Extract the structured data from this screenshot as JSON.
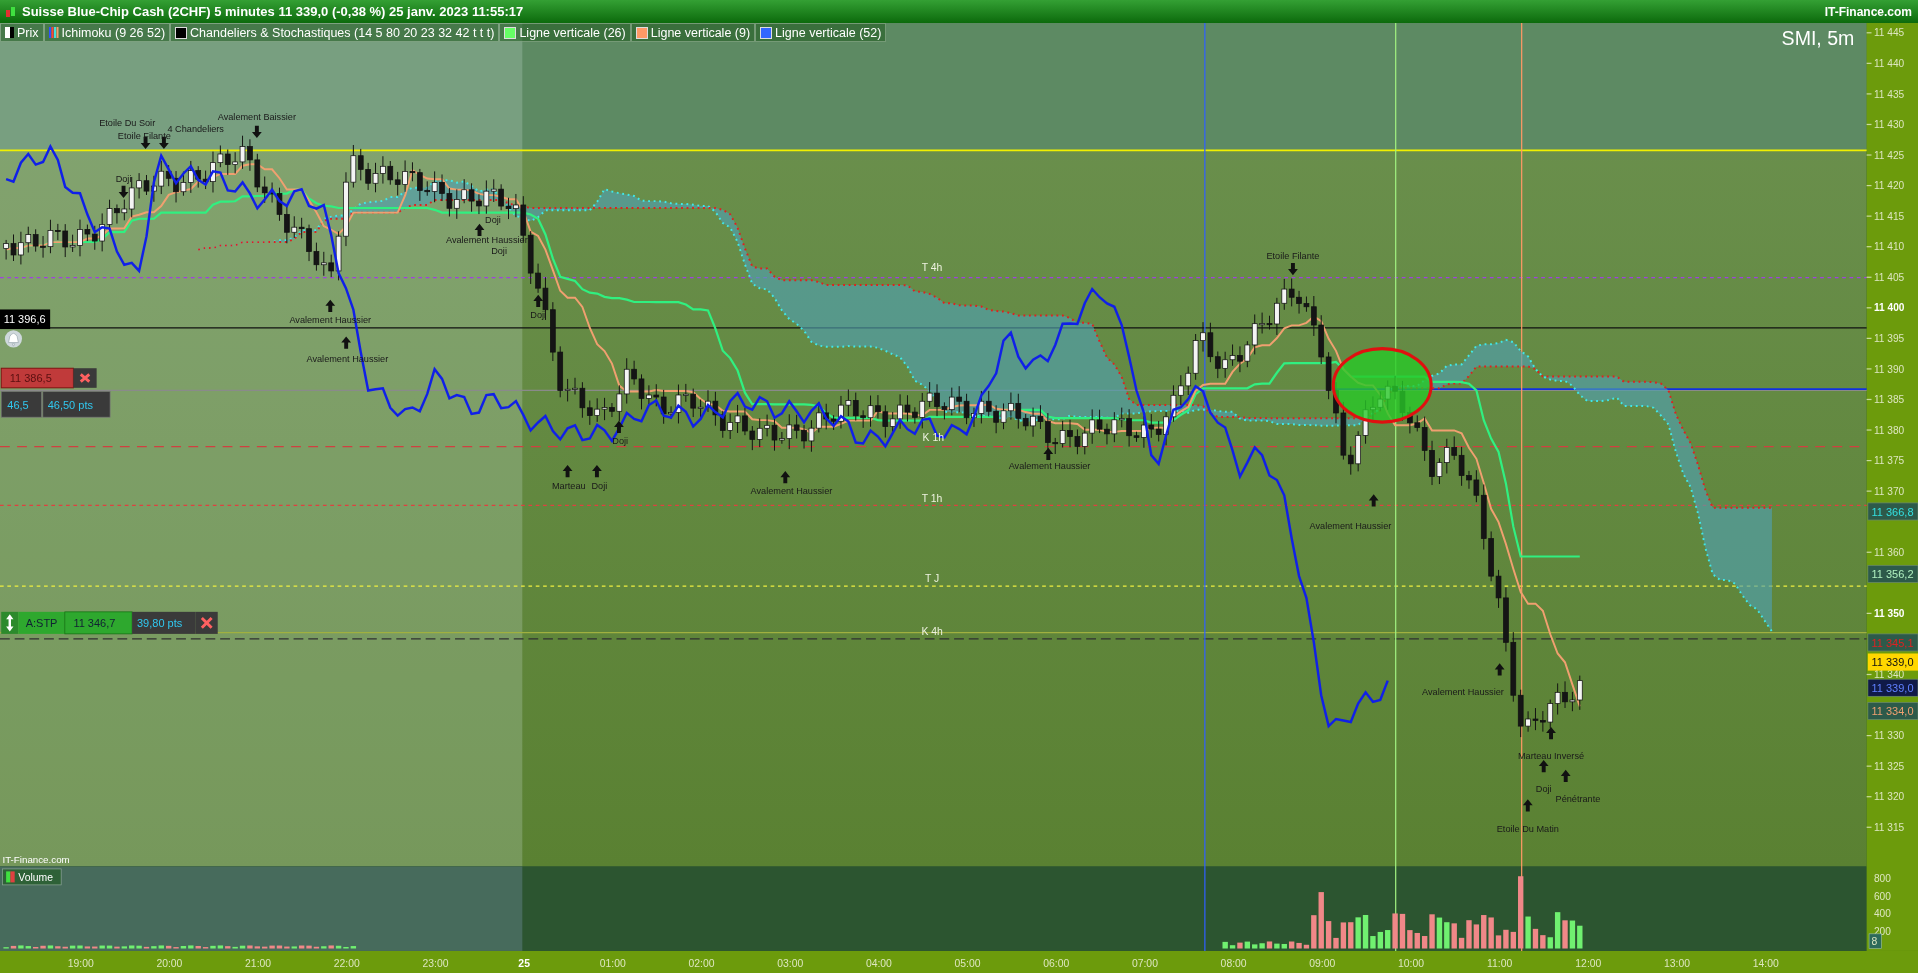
{
  "title_bar": {
    "title": "Suisse Blue-Chip Cash (2CHF) 5 minutes 11 339,0 (-0,38 %) 25 janv. 2023 11:55:17",
    "brand": "IT-Finance.com"
  },
  "legend": [
    {
      "kind": "prix",
      "label": "Prix"
    },
    {
      "kind": "ichimoku",
      "label": "Ichimoku (9 26 52)"
    },
    {
      "kind": "swatch",
      "label": "Chandeliers & Stochastiques (14 5 80 20 23 32 42 t t t)",
      "color": "#000000"
    },
    {
      "kind": "swatch",
      "label": "Ligne verticale (26)",
      "color": "#66ff66"
    },
    {
      "kind": "swatch",
      "label": "Ligne verticale (9)",
      "color": "#ff9966"
    },
    {
      "kind": "swatch",
      "label": "Ligne verticale (52)",
      "color": "#3366ff"
    }
  ],
  "chart": {
    "symbol": "SMI, 5m",
    "source": "IT-Finance.com",
    "cursor_price": "11 396,6",
    "order": {
      "price": "11 386,5",
      "distance": "46,5",
      "distance_pts": "46,50 pts"
    },
    "stop": {
      "type_label": "A:STP",
      "price": "11 346,7",
      "distance_pts": "39,80 pts"
    },
    "line_labels": [
      "T 4h",
      "K 1h",
      "T 1h",
      "T J",
      "K 4h"
    ],
    "patterns": [
      {
        "text": "Etoile Du Soir",
        "kind": "down"
      },
      {
        "text": "4 Chandeliers",
        "kind": "down"
      },
      {
        "text": "Etoile Filante",
        "kind": "plain"
      },
      {
        "text": "Avalement Baissier",
        "kind": "down"
      },
      {
        "text": "Doji",
        "kind": "down"
      },
      {
        "text": "Avalement Haussier",
        "kind": "up"
      },
      {
        "text": "Avalement Haussier",
        "kind": "up"
      },
      {
        "text": "Doji",
        "kind": "plain"
      },
      {
        "text": "Avalement Haussier",
        "kind": "up"
      },
      {
        "text": "Doji",
        "kind": "plain"
      },
      {
        "text": "Doji",
        "kind": "up"
      },
      {
        "text": "Marteau",
        "kind": "up"
      },
      {
        "text": "Doji",
        "kind": "up"
      },
      {
        "text": "Doji",
        "kind": "up"
      },
      {
        "text": "Avalement Haussier",
        "kind": "up"
      },
      {
        "text": "Avalement Haussier",
        "kind": "up"
      },
      {
        "text": "Etoile Filante",
        "kind": "down"
      },
      {
        "text": "Avalement Haussier",
        "kind": "up"
      },
      {
        "text": "Avalement Haussier",
        "kind": "up"
      },
      {
        "text": "Marteau Inversé",
        "kind": "up"
      },
      {
        "text": "Doji",
        "kind": "up"
      },
      {
        "text": "Pénétrante",
        "kind": "up"
      },
      {
        "text": "Etoile Du Matin",
        "kind": "up"
      }
    ],
    "price_axis": {
      "ticks": [
        {
          "label": "11 445",
          "major": false
        },
        {
          "label": "11 440",
          "major": false
        },
        {
          "label": "11 435",
          "major": false
        },
        {
          "label": "11 430",
          "major": false
        },
        {
          "label": "11 425",
          "major": false
        },
        {
          "label": "11 420",
          "major": false
        },
        {
          "label": "11 415",
          "major": false
        },
        {
          "label": "11 410",
          "major": false
        },
        {
          "label": "11 405",
          "major": false
        },
        {
          "label": "11 400",
          "major": true
        },
        {
          "label": "11 395",
          "major": false
        },
        {
          "label": "11 390",
          "major": false
        },
        {
          "label": "11 385",
          "major": false
        },
        {
          "label": "11 380",
          "major": false
        },
        {
          "label": "11 375",
          "major": false
        },
        {
          "label": "11 370",
          "major": false
        },
        {
          "label": "11 360",
          "major": false
        },
        {
          "label": "11 350",
          "major": true
        },
        {
          "label": "11 340",
          "major": false
        },
        {
          "label": "11 330",
          "major": false
        },
        {
          "label": "11 325",
          "major": false
        },
        {
          "label": "11 320",
          "major": false
        },
        {
          "label": "11 315",
          "major": false
        }
      ],
      "markers": [
        {
          "label": "11 366,8",
          "color": "#33e0e0",
          "filled": false
        },
        {
          "label": "11 356,2",
          "color": "#b0f0c0",
          "filled": false
        },
        {
          "label": "11 345,1",
          "color": "#e02020",
          "filled": false
        },
        {
          "label": "11 339,0",
          "color": "#ffd700",
          "filled": true
        },
        {
          "label": "11 339,0",
          "color": "#6080ff",
          "filled": false
        },
        {
          "label": "11 334,0",
          "color": "#f0a070",
          "filled": false
        }
      ]
    }
  },
  "volume": {
    "label": "Volume",
    "ticks": [
      "800",
      "600",
      "400",
      "200"
    ],
    "marker": "8"
  },
  "time_axis": [
    {
      "label": "19:00",
      "major": false
    },
    {
      "label": "20:00",
      "major": false
    },
    {
      "label": "21:00",
      "major": false
    },
    {
      "label": "22:00",
      "major": false
    },
    {
      "label": "23:00",
      "major": false
    },
    {
      "label": "25",
      "major": true
    },
    {
      "label": "01:00",
      "major": false
    },
    {
      "label": "02:00",
      "major": false
    },
    {
      "label": "03:00",
      "major": false
    },
    {
      "label": "04:00",
      "major": false
    },
    {
      "label": "05:00",
      "major": false
    },
    {
      "label": "06:00",
      "major": false
    },
    {
      "label": "07:00",
      "major": false
    },
    {
      "label": "08:00",
      "major": false
    },
    {
      "label": "09:00",
      "major": false
    },
    {
      "label": "10:00",
      "major": false
    },
    {
      "label": "11:00",
      "major": false
    },
    {
      "label": "12:00",
      "major": false
    },
    {
      "label": "13:00",
      "major": false
    },
    {
      "label": "14:00",
      "major": false
    }
  ]
}
